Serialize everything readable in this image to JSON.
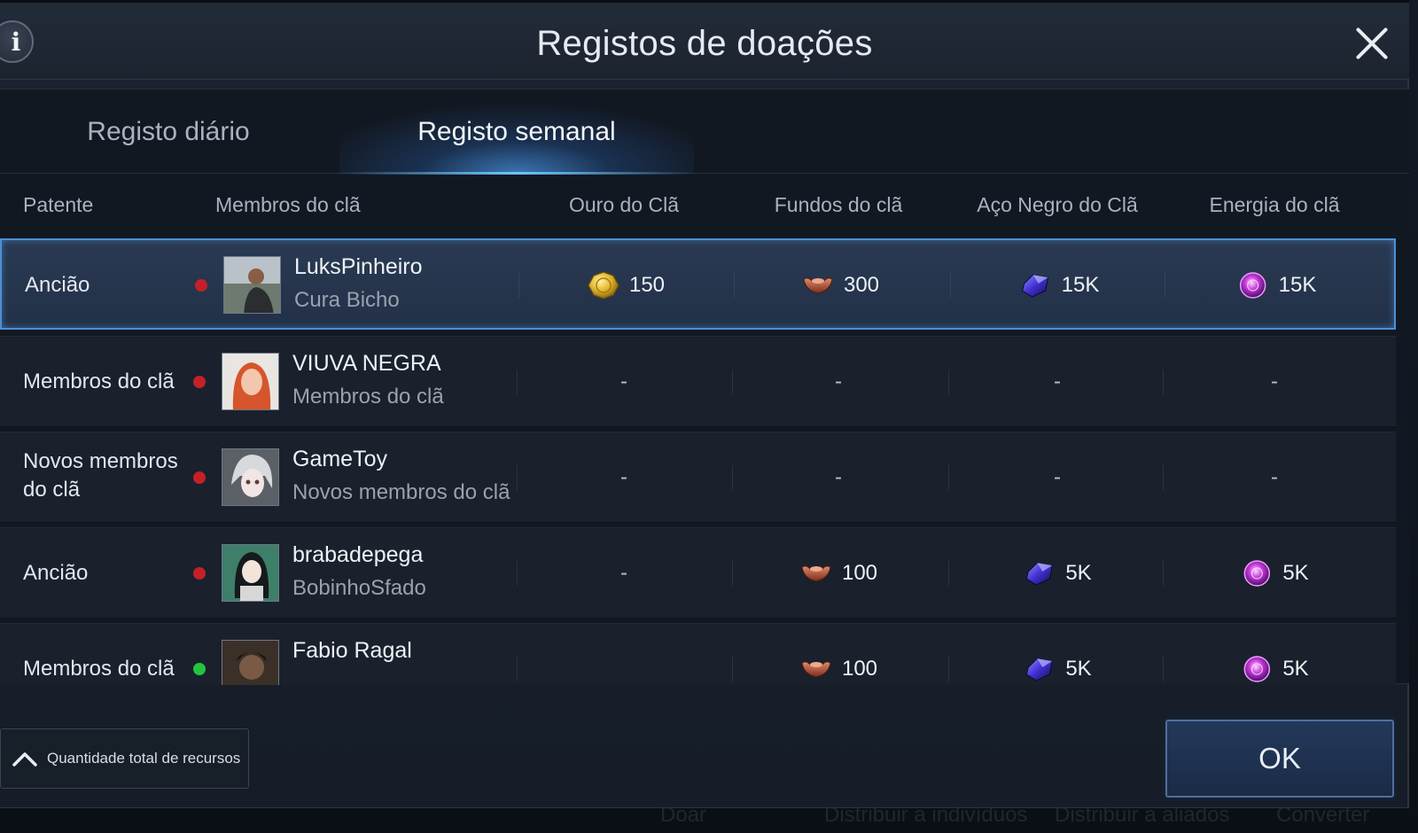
{
  "dialog": {
    "title": "Registos de doações",
    "info_icon": "i"
  },
  "tabs": [
    {
      "label": "Registo diário",
      "active": false
    },
    {
      "label": "Registo semanal",
      "active": true
    }
  ],
  "columns": {
    "rank": "Patente",
    "member": "Membros do clã",
    "gold": "Ouro do Clã",
    "funds": "Fundos do clã",
    "black_steel": "Aço Negro do Clã",
    "energy": "Energia do clã"
  },
  "rows": [
    {
      "rank": "Ancião",
      "status": "offline",
      "name": "LuksPinheiro",
      "subtitle": "Cura Bicho",
      "gold": "150",
      "funds": "300",
      "black_steel": "15K",
      "energy": "15K",
      "selected": true
    },
    {
      "rank": "Membros do clã",
      "status": "offline",
      "name": "VIUVA NEGRA",
      "subtitle": "Membros do clã",
      "gold": "-",
      "funds": "-",
      "black_steel": "-",
      "energy": "-",
      "selected": false
    },
    {
      "rank": "Novos membros do clã",
      "status": "offline",
      "name": "GameToy",
      "subtitle": "Novos membros do clã",
      "gold": "-",
      "funds": "-",
      "black_steel": "-",
      "energy": "-",
      "selected": false
    },
    {
      "rank": "Ancião",
      "status": "offline",
      "name": "brabadepega",
      "subtitle": "BobinhoSfado",
      "gold": "-",
      "funds": "100",
      "black_steel": "5K",
      "energy": "5K",
      "selected": false
    },
    {
      "rank": "Membros do clã",
      "status": "online",
      "name": "Fabio Ragal",
      "subtitle": "",
      "gold": "",
      "funds": "100",
      "black_steel": "5K",
      "energy": "5K",
      "selected": false
    }
  ],
  "footer": {
    "total_toggle_label": "Quantidade total de recursos",
    "ok_label": "OK"
  },
  "background_text": [
    "Doar",
    "Distribuir a indivíduos",
    "Distribuir a aliados",
    "Converter"
  ],
  "colors": {
    "accent_blue": "#4d8fd6",
    "offline_dot": "#c42028",
    "online_dot": "#25c43e"
  },
  "icons": {
    "gold": "gold-coin-icon",
    "funds": "funds-ingot-icon",
    "black_steel": "black-steel-crystal-icon",
    "energy": "energy-orb-icon"
  }
}
